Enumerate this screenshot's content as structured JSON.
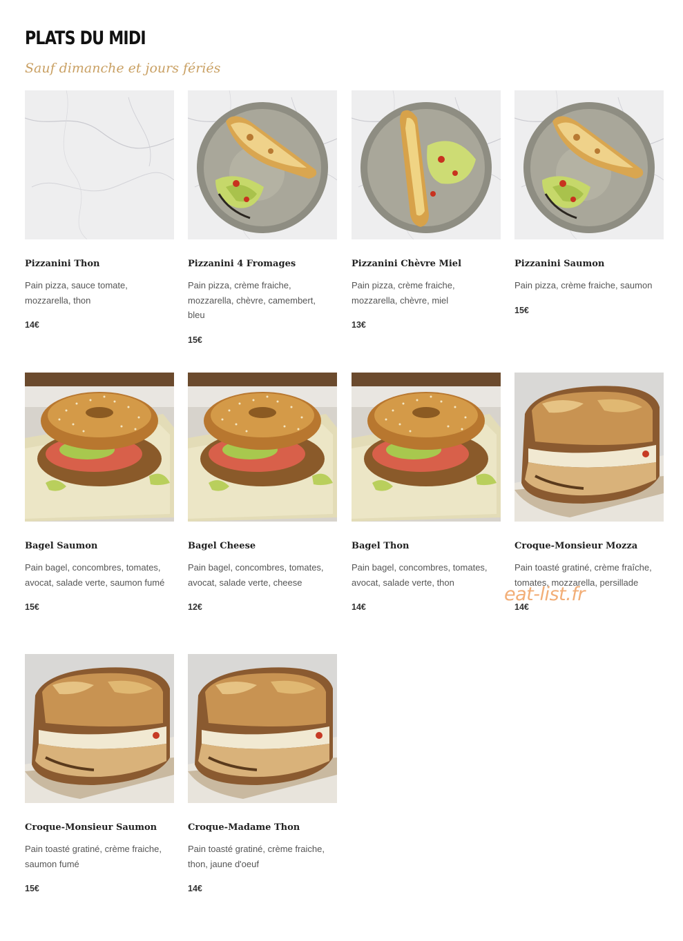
{
  "section": {
    "title": "PLATS DU MIDI",
    "subtitle": "Sauf dimanche et jours fériés"
  },
  "items": [
    {
      "name": "Pizzanini Thon",
      "description": "Pain pizza, sauce tomate, mozzarella, thon",
      "price": "14€",
      "photo": "marble-placeholder"
    },
    {
      "name": "Pizzanini 4 Fromages",
      "description": "Pain pizza, crème fraiche, mozzarella, chèvre, camembert, bleu",
      "price": "15€",
      "photo": "pizzanini-plate"
    },
    {
      "name": "Pizzanini Chèvre Miel",
      "description": "Pain pizza, crème fraiche, mozzarella, chèvre, miel",
      "price": "13€",
      "photo": "pizzanini-plate-vertical"
    },
    {
      "name": "Pizzanini Saumon",
      "description": "Pain pizza, crème fraiche, saumon",
      "price": "15€",
      "photo": "pizzanini-plate"
    },
    {
      "name": "Bagel Saumon",
      "description": "Pain bagel, concombres, tomates, avocat, salade verte, saumon fumé",
      "price": "15€",
      "photo": "bagel"
    },
    {
      "name": "Bagel Cheese",
      "description": "Pain bagel, concombres, tomates, avocat, salade verte, cheese",
      "price": "12€",
      "photo": "bagel"
    },
    {
      "name": "Bagel Thon",
      "description": "Pain bagel, concombres, tomates, avocat, salade verte, thon",
      "price": "14€",
      "photo": "bagel"
    },
    {
      "name": "Croque-Monsieur Mozza",
      "description": "Pain toasté gratiné, crème fraîche, tomates, mozzarella, persillade",
      "price": "14€",
      "photo": "croque"
    },
    {
      "name": "Croque-Monsieur Saumon",
      "description": "Pain toasté gratiné, crème fraiche, saumon fumé",
      "price": "15€",
      "photo": "croque"
    },
    {
      "name": "Croque-Madame Thon",
      "description": "Pain toasté gratiné, crème fraiche, thon, jaune d'oeuf",
      "price": "14€",
      "photo": "croque"
    }
  ],
  "watermark": "eat-list.fr"
}
